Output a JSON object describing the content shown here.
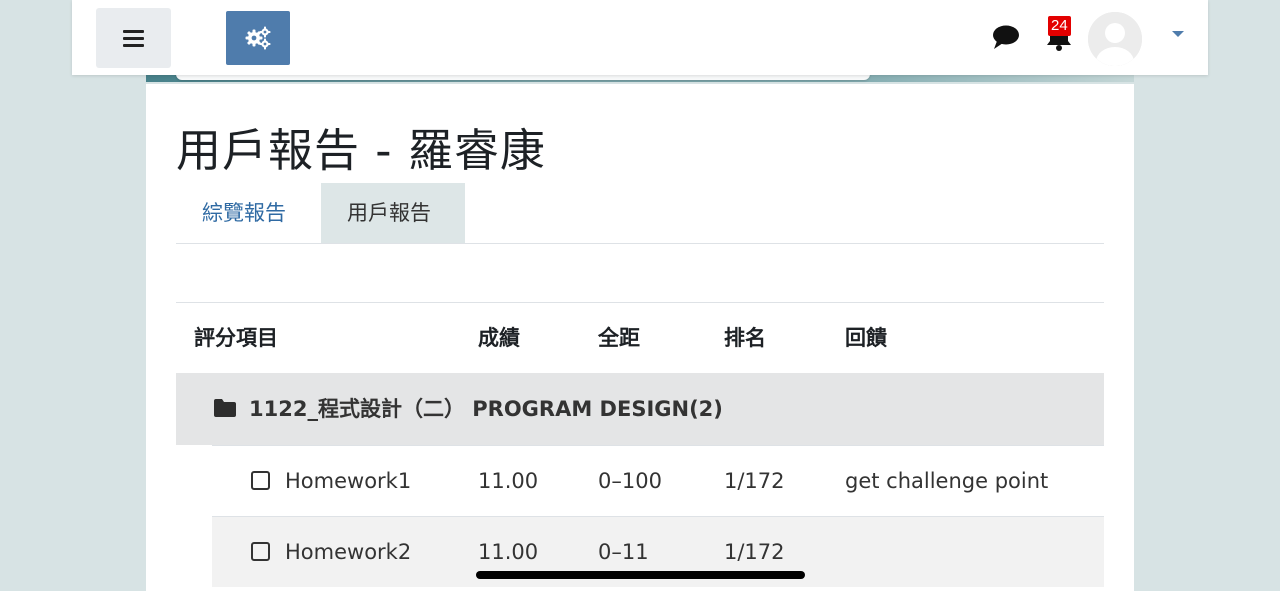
{
  "colors": {
    "brand": "#4f7cac",
    "badge": "#e30000",
    "link": "#2f6aa3",
    "active_tab_bg": "#dde6e7",
    "category_bg": "#e4e5e6"
  },
  "navbar": {
    "menu_icon": "hamburger-icon",
    "admin_icon": "gears-icon",
    "messages_icon": "speech-bubble-icon",
    "notifications_icon": "bell-icon",
    "notification_count": "24",
    "user_menu_icon": "caret-down-icon"
  },
  "page": {
    "title": "用戶報告 - 羅睿康"
  },
  "tabs": [
    {
      "label": "綜覽報告",
      "active": false
    },
    {
      "label": "用戶報告",
      "active": true
    }
  ],
  "table": {
    "headers": {
      "item": "評分項目",
      "grade": "成績",
      "range": "全距",
      "rank": "排名",
      "feedback": "回饋"
    },
    "category": {
      "icon": "folder-icon",
      "name": "1122_程式設計（二） PROGRAM DESIGN(2)"
    },
    "rows": [
      {
        "name": "Homework1",
        "grade": "11.00",
        "range": "0–100",
        "rank": "1/172",
        "feedback": "get challenge point"
      },
      {
        "name": "Homework2",
        "grade": "11.00",
        "range": "0–11",
        "rank": "1/172",
        "feedback": ""
      }
    ]
  }
}
